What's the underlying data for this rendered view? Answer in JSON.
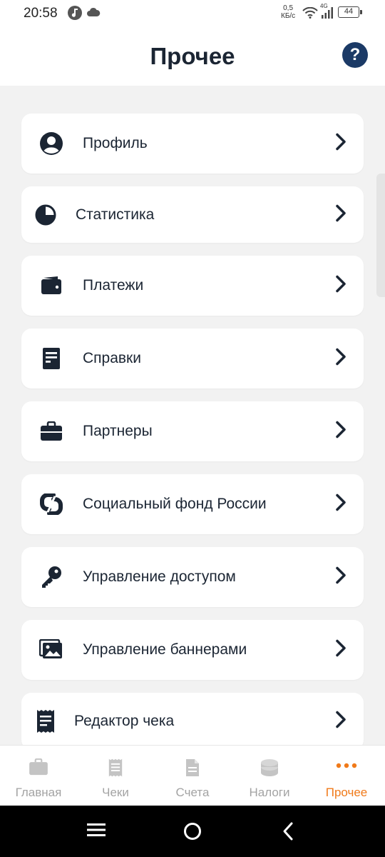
{
  "status_bar": {
    "time": "20:58",
    "speed_value": "0,5",
    "speed_unit": "КБ/с",
    "network": "4G",
    "battery": "44"
  },
  "header": {
    "title": "Прочее",
    "help_label": "?"
  },
  "menu": [
    {
      "label": "Профиль",
      "icon": "profile-icon"
    },
    {
      "label": "Статистика",
      "icon": "pie-chart-icon"
    },
    {
      "label": "Платежи",
      "icon": "wallet-icon"
    },
    {
      "label": "Справки",
      "icon": "document-icon"
    },
    {
      "label": "Партнеры",
      "icon": "briefcase-icon"
    },
    {
      "label": "Социальный фонд России",
      "icon": "social-fund-logo-icon"
    },
    {
      "label": "Управление доступом",
      "icon": "key-icon"
    },
    {
      "label": "Управление баннерами",
      "icon": "image-icon"
    },
    {
      "label": "Редактор чека",
      "icon": "receipt-icon"
    }
  ],
  "bottom_nav": [
    {
      "label": "Главная",
      "icon": "briefcase-icon",
      "active": false
    },
    {
      "label": "Чеки",
      "icon": "receipt-icon",
      "active": false
    },
    {
      "label": "Счета",
      "icon": "document-icon",
      "active": false
    },
    {
      "label": "Налоги",
      "icon": "coins-icon",
      "active": false
    },
    {
      "label": "Прочее",
      "icon": "more-dots-icon",
      "active": true
    }
  ],
  "colors": {
    "accent": "#f07a1a",
    "primary_dark": "#1b2533",
    "help_bg": "#1b3a66",
    "background": "#f2f2f2",
    "inactive": "#a3a3a3"
  }
}
